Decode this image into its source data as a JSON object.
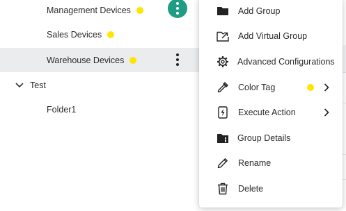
{
  "tree": {
    "items": [
      {
        "label": "Management Devices",
        "tag_color": "#ffe500"
      },
      {
        "label": "Sales Devices",
        "tag_color": "#ffe500"
      },
      {
        "label": "Warehouse Devices",
        "tag_color": "#ffe500"
      },
      {
        "label": "Test"
      },
      {
        "label": "Folder1"
      }
    ]
  },
  "context_menu": {
    "items": [
      {
        "label": "Add Group",
        "icon": "folder-icon"
      },
      {
        "label": "Add Virtual Group",
        "icon": "folder-link-icon"
      },
      {
        "label": "Advanced Configurations",
        "icon": "gear-cog-icon"
      },
      {
        "label": "Color Tag",
        "icon": "eyedropper-icon",
        "swatch": "#ffe500",
        "has_submenu": true
      },
      {
        "label": "Execute Action",
        "icon": "lightning-icon",
        "has_submenu": true
      },
      {
        "label": "Group Details",
        "icon": "folder-info-icon"
      },
      {
        "label": "Rename",
        "icon": "pencil-icon"
      },
      {
        "label": "Delete",
        "icon": "trash-icon"
      }
    ]
  },
  "colors": {
    "accent": "#1f9c83",
    "tag_yellow": "#ffe500",
    "selected_row": "#eaecee"
  }
}
